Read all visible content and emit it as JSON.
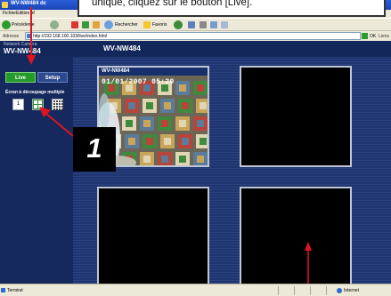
{
  "window": {
    "title": "WV-NW484 dc"
  },
  "menu": {
    "items": [
      "Fichier",
      "Edition",
      "Af"
    ]
  },
  "toolbar": {
    "back": "Précédente",
    "search": "Rechercher",
    "favorites": "Favoris"
  },
  "address": {
    "label": "Adresse",
    "url": "http://192.168.100.103/live/index.html",
    "go": "OK",
    "links": "Liens"
  },
  "app": {
    "network_label": "Network Camera",
    "model": "WV-NW484",
    "header_title": "WV-NW484"
  },
  "sidebar": {
    "live_label": "Live",
    "setup_label": "Setup",
    "multi_screen_label": "Écran à découpage multiple",
    "single_button": "1"
  },
  "cameras": [
    {
      "title": "WV-NW484",
      "timestamp": "01/01/2007 05:20"
    }
  ],
  "callout": {
    "text": "unique, cliquez sur le bouton [Live].",
    "badge": "1"
  },
  "status": {
    "done": "Terminé",
    "zone": "Internet"
  },
  "colors": {
    "accent_green": "#249a2b",
    "header_navy": "#14275a",
    "arrow_red": "#e0141e"
  }
}
